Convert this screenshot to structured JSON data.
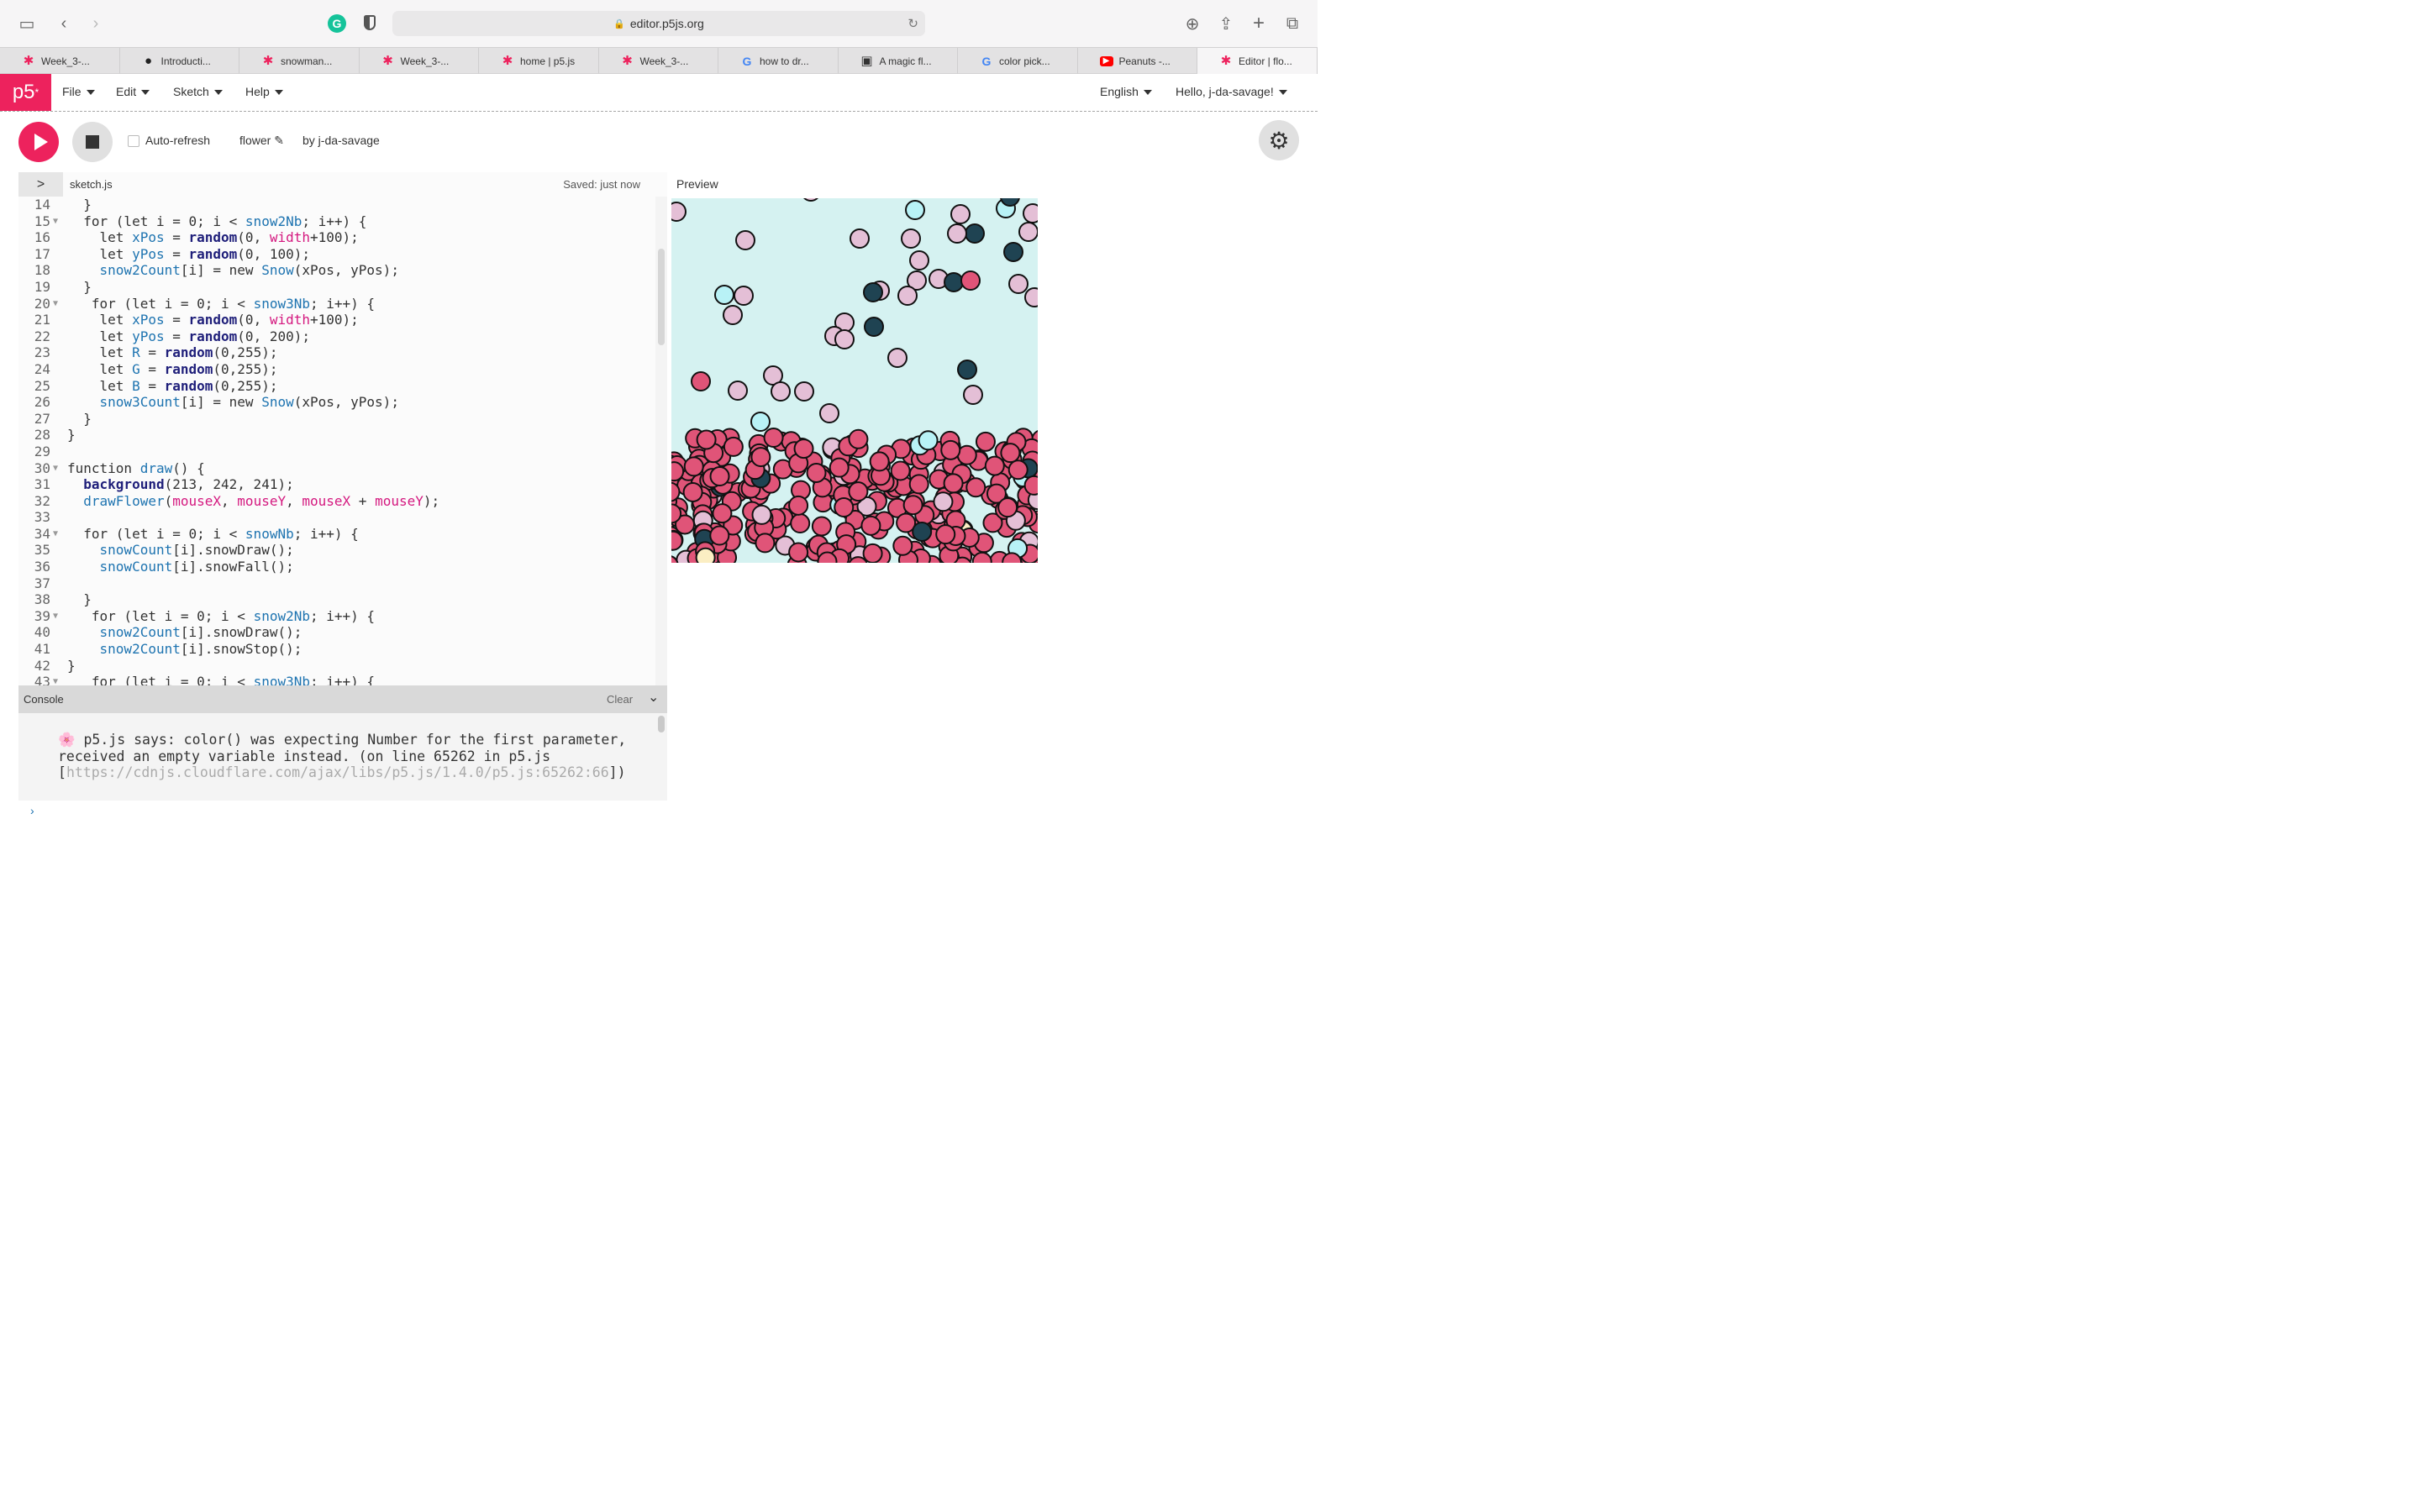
{
  "browser": {
    "url": "editor.p5js.org",
    "tabs": [
      {
        "label": "Week_3-...",
        "icon": "p5-asterisk-icon",
        "color": "#ed225d"
      },
      {
        "label": "Introducti...",
        "icon": "github-icon",
        "color": "#222222"
      },
      {
        "label": "snowman...",
        "icon": "p5-asterisk-icon",
        "color": "#ed225d"
      },
      {
        "label": "Week_3-...",
        "icon": "p5-asterisk-icon",
        "color": "#ed225d"
      },
      {
        "label": "home | p5.js",
        "icon": "p5-asterisk-icon",
        "color": "#ed225d"
      },
      {
        "label": "Week_3-...",
        "icon": "p5-asterisk-icon",
        "color": "#ed225d"
      },
      {
        "label": "how to dr...",
        "icon": "google-icon",
        "color": "#4285f4"
      },
      {
        "label": "A magic fl...",
        "icon": "image-icon",
        "color": "#333333"
      },
      {
        "label": "color pick...",
        "icon": "google-icon",
        "color": "#4285f4"
      },
      {
        "label": "Peanuts -...",
        "icon": "youtube-icon",
        "color": "#ff0000"
      },
      {
        "label": "Editor | flo...",
        "icon": "p5-asterisk-icon",
        "color": "#ed225d"
      }
    ]
  },
  "p5nav": {
    "logo": "p5",
    "logo_sup": "*",
    "menus": [
      "File",
      "Edit",
      "Sketch",
      "Help"
    ],
    "language": "English",
    "user": "Hello, j-da-savage!"
  },
  "toolbar": {
    "auto_refresh": "Auto-refresh",
    "sketch_name": "flower ✎",
    "by_user": "by j-da-savage"
  },
  "editor": {
    "file_name": "sketch.js",
    "saved": "Saved: just now",
    "lines": [
      {
        "n": "14",
        "fold": false,
        "html": "  }"
      },
      {
        "n": "15",
        "fold": true,
        "html": "  for (let i = 0; i < <span class='bl'>snow2Nb</span>; i++) {"
      },
      {
        "n": "16",
        "fold": false,
        "html": "    let <span class='bl'>xPos</span> = <span class='fn'>random</span>(0, <span class='pk'>width</span>+100);"
      },
      {
        "n": "17",
        "fold": false,
        "html": "    let <span class='bl'>yPos</span> = <span class='fn'>random</span>(0, 100);"
      },
      {
        "n": "18",
        "fold": false,
        "html": "    <span class='bl'>snow2Count</span>[i] = new <span class='bl'>Snow</span>(xPos, yPos);"
      },
      {
        "n": "19",
        "fold": false,
        "html": "  }"
      },
      {
        "n": "20",
        "fold": true,
        "html": "   for (let i = 0; i < <span class='bl'>snow3Nb</span>; i++) {"
      },
      {
        "n": "21",
        "fold": false,
        "html": "    let <span class='bl'>xPos</span> = <span class='fn'>random</span>(0, <span class='pk'>width</span>+100);"
      },
      {
        "n": "22",
        "fold": false,
        "html": "    let <span class='bl'>yPos</span> = <span class='fn'>random</span>(0, 200);"
      },
      {
        "n": "23",
        "fold": false,
        "html": "    let <span class='bl'>R</span> = <span class='fn'>random</span>(0,255);"
      },
      {
        "n": "24",
        "fold": false,
        "html": "    let <span class='bl'>G</span> = <span class='fn'>random</span>(0,255);"
      },
      {
        "n": "25",
        "fold": false,
        "html": "    let <span class='bl'>B</span> = <span class='fn'>random</span>(0,255);"
      },
      {
        "n": "26",
        "fold": false,
        "html": "    <span class='bl'>snow3Count</span>[i] = new <span class='bl'>Snow</span>(xPos, yPos);"
      },
      {
        "n": "27",
        "fold": false,
        "html": "  }"
      },
      {
        "n": "28",
        "fold": false,
        "html": "}"
      },
      {
        "n": "29",
        "fold": false,
        "html": ""
      },
      {
        "n": "30",
        "fold": true,
        "html": "function <span class='bl'>draw</span>() {"
      },
      {
        "n": "31",
        "fold": false,
        "html": "  <span class='fn'>background</span>(213, 242, 241);"
      },
      {
        "n": "32",
        "fold": false,
        "html": "  <span class='bl'>drawFlower</span>(<span class='pk'>mouseX</span>, <span class='pk'>mouseY</span>, <span class='pk'>mouseX</span> + <span class='pk'>mouseY</span>);"
      },
      {
        "n": "33",
        "fold": false,
        "html": ""
      },
      {
        "n": "34",
        "fold": true,
        "html": "  for (let i = 0; i < <span class='bl'>snowNb</span>; i++) {"
      },
      {
        "n": "35",
        "fold": false,
        "html": "    <span class='bl'>snowCount</span>[i].snowDraw();"
      },
      {
        "n": "36",
        "fold": false,
        "html": "    <span class='bl'>snowCount</span>[i].snowFall();"
      },
      {
        "n": "37",
        "fold": false,
        "html": ""
      },
      {
        "n": "38",
        "fold": false,
        "html": "  }"
      },
      {
        "n": "39",
        "fold": true,
        "html": "   for (let i = 0; i < <span class='bl'>snow2Nb</span>; i++) {"
      },
      {
        "n": "40",
        "fold": false,
        "html": "    <span class='bl'>snow2Count</span>[i].snowDraw();"
      },
      {
        "n": "41",
        "fold": false,
        "html": "    <span class='bl'>snow2Count</span>[i].snowStop();"
      },
      {
        "n": "42",
        "fold": false,
        "html": "}"
      },
      {
        "n": "43",
        "fold": true,
        "html": "   for (let i = 0; i < <span class='bl'>snow3Nb</span>; i++) {"
      }
    ]
  },
  "console": {
    "title": "Console",
    "clear": "Clear",
    "emoji": "🌸",
    "message": " p5.js says: color() was expecting Number for the first parameter, received an empty variable instead. (on line 65262 in p5.js [",
    "link": "https://cdnjs.cloudflare.com/ajax/libs/p5.js/1.4.0/p5.js:65262:66",
    "message_end": "])"
  },
  "preview": {
    "label": "Preview",
    "background": "#d5f2f1",
    "colors": {
      "pink": "#e05478",
      "lilac": "#e4bfd6",
      "cyan": "#b8f2f6",
      "navy": "#1f4352",
      "cream": "#fbeec3"
    }
  }
}
